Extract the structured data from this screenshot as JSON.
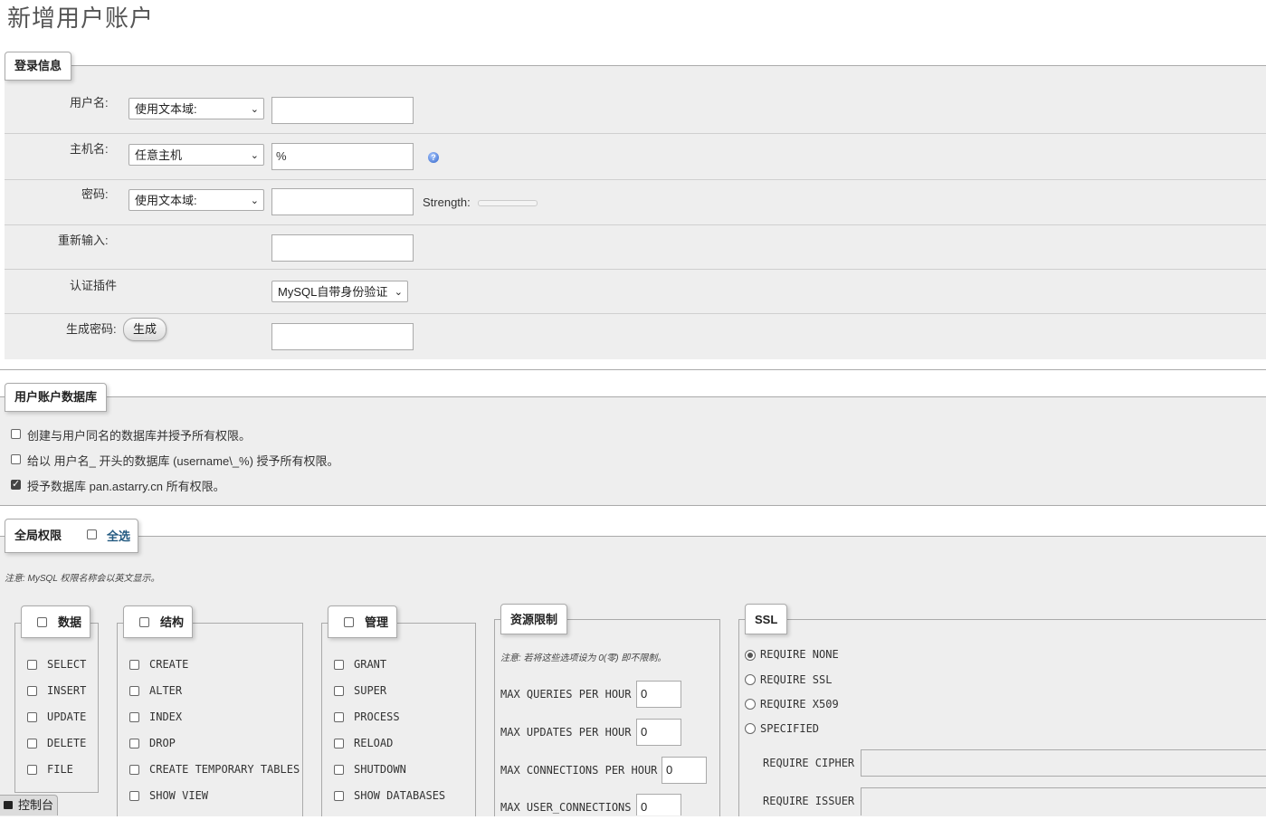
{
  "title": "新增用户账户",
  "login": {
    "legend": "登录信息",
    "username_label": "用户名:",
    "username_select": "使用文本域:",
    "username_value": "",
    "hostname_label": "主机名:",
    "hostname_select": "任意主机",
    "hostname_value": "%",
    "password_label": "密码:",
    "password_select": "使用文本域:",
    "password_value": "",
    "strength_label": "Strength:",
    "reenter_label": "重新输入:",
    "reenter_value": "",
    "auth_plugin_label": "认证插件",
    "auth_plugin_select": "MySQL自带身份验证",
    "generate_label": "生成密码:",
    "generate_button": "生成",
    "generated_value": ""
  },
  "database": {
    "legend": "用户账户数据库",
    "options": [
      {
        "label": "创建与用户同名的数据库并授予所有权限。",
        "checked": false
      },
      {
        "label": "给以 用户名_ 开头的数据库 (username\\_%) 授予所有权限。",
        "checked": false
      },
      {
        "label": "授予数据库 pan.astarry.cn 所有权限。",
        "checked": true
      }
    ]
  },
  "global": {
    "legend": "全局权限",
    "select_all": "全选",
    "note": "注意: MySQL 权限名称会以英文显示。",
    "groups": {
      "data": {
        "legend": "数据",
        "items": [
          "SELECT",
          "INSERT",
          "UPDATE",
          "DELETE",
          "FILE"
        ]
      },
      "structure": {
        "legend": "结构",
        "items": [
          "CREATE",
          "ALTER",
          "INDEX",
          "DROP",
          "CREATE TEMPORARY TABLES",
          "SHOW VIEW"
        ]
      },
      "admin": {
        "legend": "管理",
        "items": [
          "GRANT",
          "SUPER",
          "PROCESS",
          "RELOAD",
          "SHUTDOWN",
          "SHOW DATABASES"
        ]
      },
      "resources": {
        "legend": "资源限制",
        "note": "注意: 若将这些选项设为 0(零) 即不限制。",
        "items": [
          {
            "label": "MAX QUERIES PER HOUR",
            "value": "0"
          },
          {
            "label": "MAX UPDATES PER HOUR",
            "value": "0"
          },
          {
            "label": "MAX CONNECTIONS PER HOUR",
            "value": "0"
          },
          {
            "label": "MAX USER_CONNECTIONS",
            "value": "0"
          }
        ]
      },
      "ssl": {
        "legend": "SSL",
        "options": [
          {
            "label": "REQUIRE NONE",
            "checked": true
          },
          {
            "label": "REQUIRE SSL",
            "checked": false
          },
          {
            "label": "REQUIRE X509",
            "checked": false
          },
          {
            "label": "SPECIFIED",
            "checked": false
          }
        ],
        "cipher_label": "REQUIRE CIPHER",
        "issuer_label": "REQUIRE ISSUER"
      }
    }
  },
  "console": {
    "label": "控制台"
  }
}
